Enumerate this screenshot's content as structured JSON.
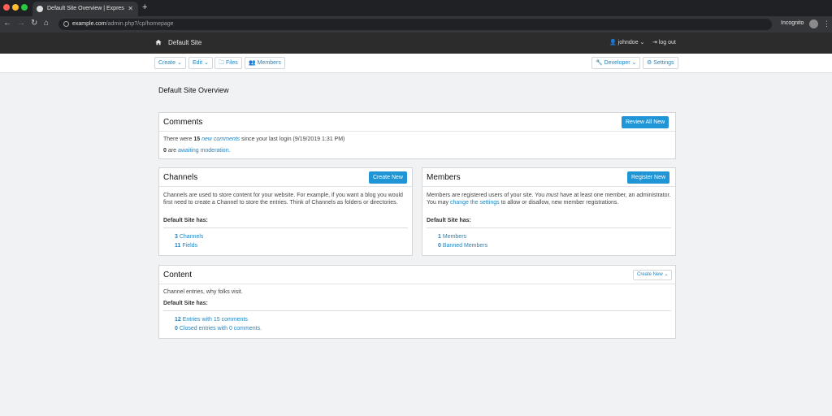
{
  "browser": {
    "tab_title": "Default Site Overview | Expres",
    "url_host": "example.com",
    "url_path": "/admin.php?/cp/homepage",
    "incognito_label": "Incognito"
  },
  "header": {
    "site_name": "Default Site",
    "username": "johndoe",
    "logout_label": "log out"
  },
  "subnav": {
    "create": "Create",
    "edit": "Edit",
    "files": "Files",
    "members": "Members",
    "developer": "Developer",
    "settings": "Settings"
  },
  "page_title": "Default Site Overview",
  "comments": {
    "title": "Comments",
    "button": "Review All New",
    "line1_pre": "There were",
    "line1_count": "15",
    "line1_link": "new comments",
    "line1_post": "since your last login (9/19/2019 1:31 PM)",
    "line2_count": "0",
    "line2_pre": "are",
    "line2_link": "awaiting moderation."
  },
  "channels": {
    "title": "Channels",
    "button": "Create New",
    "desc": "Channels are used to store content for your website. For example, if you want a blog you would first need to create a Channel to store the entries. Think of Channels as folders or directories.",
    "has_label": "Default Site has:",
    "items": [
      {
        "count": "3",
        "label": "Channels"
      },
      {
        "count": "11",
        "label": "Fields"
      }
    ]
  },
  "members": {
    "title": "Members",
    "button": "Register New",
    "desc_pre": "Members are registered users of your site. You",
    "desc_em": "must",
    "desc_mid": "have at least one member, an administrator. You may",
    "desc_link": "change the settings",
    "desc_post": "to allow or disallow, new member registrations.",
    "has_label": "Default Site has:",
    "items": [
      {
        "count": "1",
        "label": "Members"
      },
      {
        "count": "0",
        "label": "Banned Members"
      }
    ]
  },
  "content": {
    "title": "Content",
    "button": "Create New",
    "desc": "Channel entries, why folks visit.",
    "has_label": "Default Site has:",
    "items": [
      {
        "count": "12",
        "label": "Entries with 15 comments"
      },
      {
        "count": "0",
        "label": "Closed entries with 0 comments."
      }
    ]
  }
}
